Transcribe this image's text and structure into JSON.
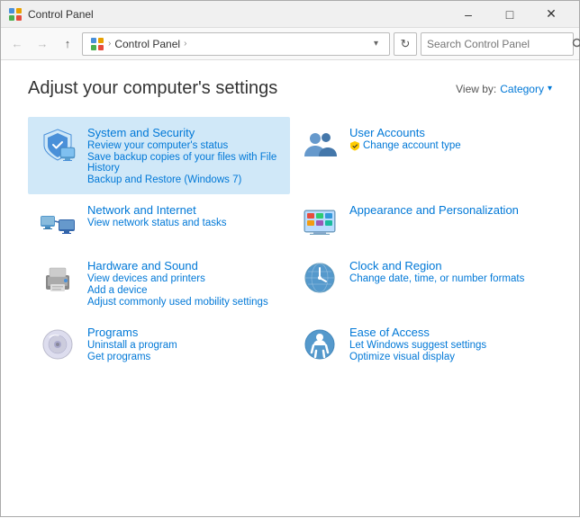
{
  "window": {
    "title": "Control Panel",
    "icon": "control-panel"
  },
  "titlebar": {
    "minimize": "–",
    "maximize": "□",
    "close": "✕"
  },
  "addressbar": {
    "back": "←",
    "forward": "→",
    "up": "↑",
    "refresh": "↻",
    "path": "Control Panel",
    "path_full": "Control Panel",
    "dropdown": "▾",
    "search_placeholder": "Search Control Panel",
    "search_icon": "🔍"
  },
  "page": {
    "title": "Adjust your computer's settings",
    "viewby_label": "View by:",
    "viewby_value": "Category",
    "viewby_arrow": "▾"
  },
  "panels": [
    {
      "id": "system-security",
      "name": "System and Security",
      "highlighted": true,
      "links": [
        "Review your computer's status",
        "Save backup copies of your files with File History",
        "Backup and Restore (Windows 7)"
      ]
    },
    {
      "id": "user-accounts",
      "name": "User Accounts",
      "highlighted": false,
      "links": [
        "Change account type"
      ],
      "links_shield": [
        0
      ]
    },
    {
      "id": "network-internet",
      "name": "Network and Internet",
      "highlighted": false,
      "links": [
        "View network status and tasks"
      ]
    },
    {
      "id": "appearance-personalization",
      "name": "Appearance and Personalization",
      "highlighted": false,
      "links": []
    },
    {
      "id": "hardware-sound",
      "name": "Hardware and Sound",
      "highlighted": false,
      "links": [
        "View devices and printers",
        "Add a device",
        "Adjust commonly used mobility settings"
      ]
    },
    {
      "id": "clock-region",
      "name": "Clock and Region",
      "highlighted": false,
      "links": [
        "Change date, time, or number formats"
      ]
    },
    {
      "id": "programs",
      "name": "Programs",
      "highlighted": false,
      "links": [
        "Uninstall a program",
        "Get programs"
      ]
    },
    {
      "id": "ease-of-access",
      "name": "Ease of Access",
      "highlighted": false,
      "links": [
        "Let Windows suggest settings",
        "Optimize visual display"
      ]
    }
  ]
}
